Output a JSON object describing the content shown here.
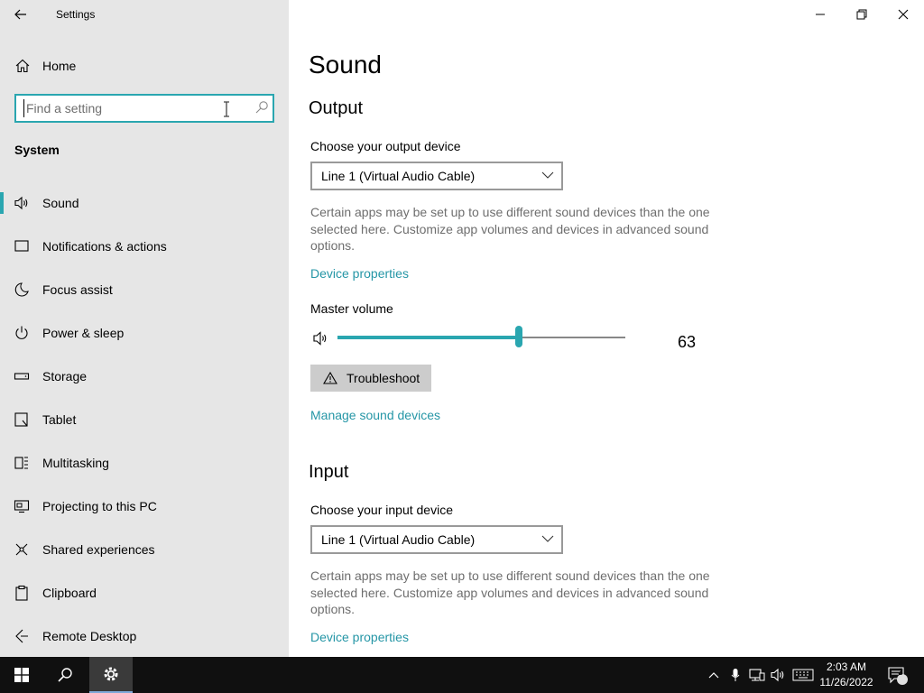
{
  "window": {
    "title": "Settings"
  },
  "sidebar": {
    "home_label": "Home",
    "search_placeholder": "Find a setting",
    "section_label": "System",
    "items": [
      {
        "label": "Sound",
        "icon": "speaker-icon",
        "active": true
      },
      {
        "label": "Notifications & actions",
        "icon": "notification-icon"
      },
      {
        "label": "Focus assist",
        "icon": "moon-icon"
      },
      {
        "label": "Power & sleep",
        "icon": "power-icon"
      },
      {
        "label": "Storage",
        "icon": "storage-icon"
      },
      {
        "label": "Tablet",
        "icon": "tablet-icon"
      },
      {
        "label": "Multitasking",
        "icon": "multitasking-icon"
      },
      {
        "label": "Projecting to this PC",
        "icon": "projecting-icon"
      },
      {
        "label": "Shared experiences",
        "icon": "shared-icon"
      },
      {
        "label": "Clipboard",
        "icon": "clipboard-icon"
      },
      {
        "label": "Remote Desktop",
        "icon": "remote-desktop-icon"
      }
    ]
  },
  "main": {
    "page_title": "Sound",
    "output": {
      "heading": "Output",
      "device_label": "Choose your output device",
      "device_value": "Line 1 (Virtual Audio Cable)",
      "description": "Certain apps may be set up to use different sound devices than the one selected here. Customize app volumes and devices in advanced sound options.",
      "device_properties_link": "Device properties",
      "master_volume_label": "Master volume",
      "volume": 63,
      "volume_text": "63",
      "troubleshoot_label": "Troubleshoot",
      "manage_devices_link": "Manage sound devices"
    },
    "input": {
      "heading": "Input",
      "device_label": "Choose your input device",
      "device_value": "Line 1 (Virtual Audio Cable)",
      "description": "Certain apps may be set up to use different sound devices than the one selected here. Customize app volumes and devices in advanced sound options.",
      "device_properties_link": "Device properties"
    }
  },
  "taskbar": {
    "time": "2:03 AM",
    "date": "11/26/2022",
    "notification_count": "3"
  },
  "colors": {
    "accent": "#2aa6b0",
    "link": "#2596a6",
    "sidebar_bg": "#e6e6e6",
    "taskbar_bg": "#101010"
  }
}
